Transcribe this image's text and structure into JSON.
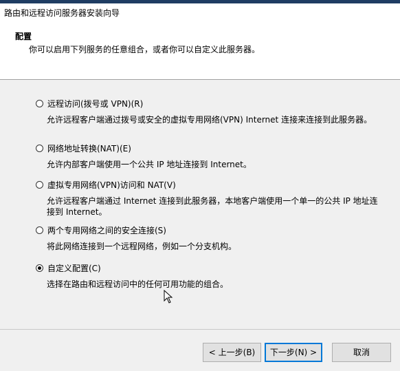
{
  "window": {
    "title": "路由和远程访问服务器安装向导"
  },
  "header": {
    "title": "配置",
    "subtitle": "你可以启用下列服务的任意组合，或者你可以自定义此服务器。"
  },
  "options": [
    {
      "label": "远程访问(拨号或 VPN)(R)",
      "description": "允许远程客户端通过拨号或安全的虚拟专用网络(VPN) Internet 连接来连接到此服务器。",
      "checked": false
    },
    {
      "label": "网络地址转换(NAT)(E)",
      "description": "允许内部客户端使用一个公共 IP 地址连接到 Internet。",
      "checked": false
    },
    {
      "label": "虚拟专用网络(VPN)访问和 NAT(V)",
      "description": "允许远程客户端通过 Internet 连接到此服务器，本地客户端使用一个单一的公共 IP 地址连接到 Internet。",
      "checked": false
    },
    {
      "label": "两个专用网络之间的安全连接(S)",
      "description": "将此网络连接到一个远程网络，例如一个分支机构。",
      "checked": false
    },
    {
      "label": "自定义配置(C)",
      "description": "选择在路由和远程访问中的任何可用功能的组合。",
      "checked": true
    }
  ],
  "buttons": {
    "back": "< 上一步(B)",
    "next": "下一步(N) >",
    "cancel": "取消"
  },
  "icons": {
    "cursor": "mouse-pointer-icon"
  }
}
